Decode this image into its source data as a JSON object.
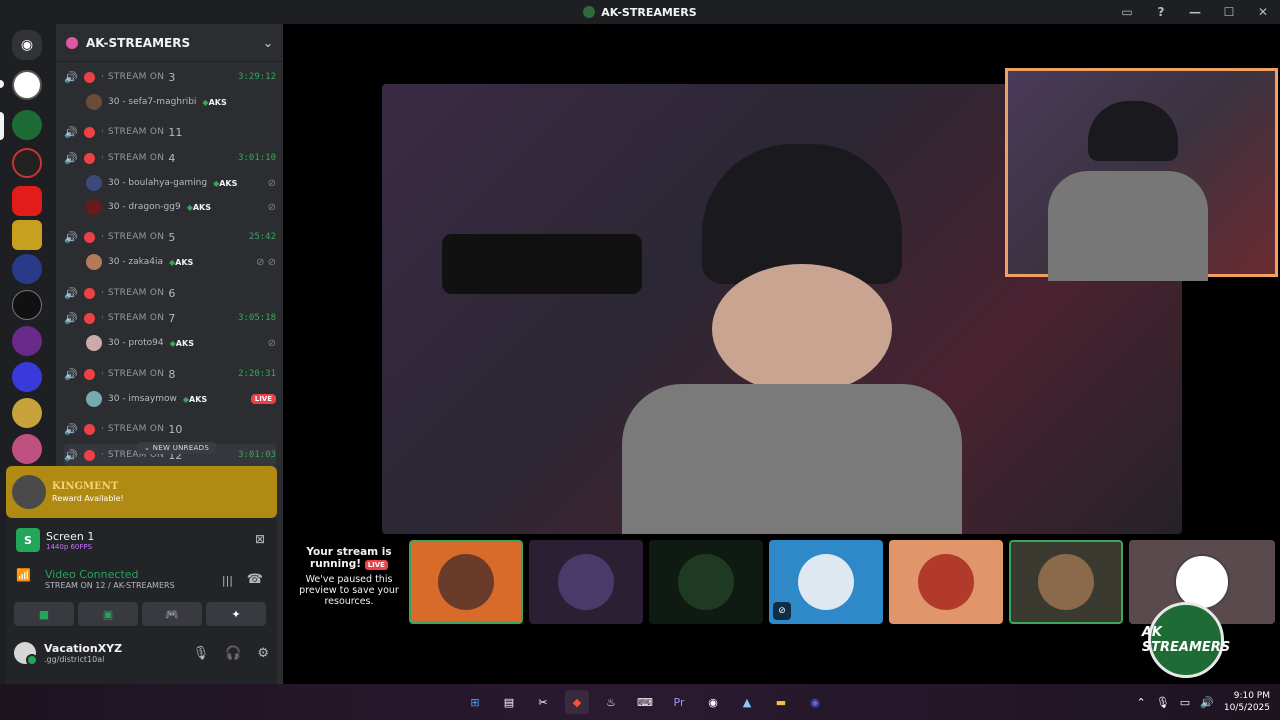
{
  "window": {
    "title": "AK-STREAMERS"
  },
  "server": {
    "name": "AK-STREAMERS"
  },
  "channels": [
    {
      "label": "STREAM ON",
      "num": "3",
      "time": "3:29:12",
      "active": true
    },
    {
      "label": "STREAM ON",
      "num": "11",
      "time": "",
      "active": false
    },
    {
      "label": "STREAM ON",
      "num": "4",
      "time": "3:01:10",
      "active": true
    },
    {
      "label": "STREAM ON",
      "num": "5",
      "time": "25:42",
      "active": true
    },
    {
      "label": "STREAM ON",
      "num": "6",
      "time": "",
      "active": false
    },
    {
      "label": "STREAM ON",
      "num": "7",
      "time": "3:05:18",
      "active": true
    },
    {
      "label": "STREAM ON",
      "num": "8",
      "time": "2:20:31",
      "active": true
    },
    {
      "label": "STREAM ON",
      "num": "10",
      "time": "",
      "active": false
    },
    {
      "label": "STREAM ON",
      "num": "12",
      "time": "3:01:03",
      "active": true
    }
  ],
  "users": [
    {
      "name": "30 - sefa7-maghribi",
      "tag": "AKS"
    },
    {
      "name": "30 - boulahya-gaming",
      "tag": "AKS"
    },
    {
      "name": "30 - dragon-gg9",
      "tag": "AKS"
    },
    {
      "name": "30 - zaka4ia",
      "tag": "AKS"
    },
    {
      "name": "30 - proto94",
      "tag": "AKS"
    },
    {
      "name": "30 - imsaymow",
      "tag": "AKS",
      "live": "LIVE"
    }
  ],
  "new_unreads": "NEW UNREADS",
  "reward": {
    "title": "KINGMENT",
    "subtitle": "Reward Available!"
  },
  "screen": {
    "icon": "S",
    "title": "Screen 1",
    "sub": "1440p 60FPS"
  },
  "voice": {
    "status": "Video Connected",
    "sub": "STREAM ON 12 / AK-STREAMERS"
  },
  "me": {
    "name": "VacationXYZ",
    "status": ".gg/district10al"
  },
  "notice": {
    "title": "Your stream is running!",
    "live": "LIVE",
    "body": "We've paused this preview to save your resources."
  },
  "badge": {
    "text": "AK STREAMERS"
  },
  "clock": {
    "time": "9:10 PM",
    "date": "10/5/2025"
  },
  "colors": {
    "accent": "#5865f2",
    "green": "#23a55a",
    "red": "#ed4245",
    "reward": "#b08a12"
  }
}
